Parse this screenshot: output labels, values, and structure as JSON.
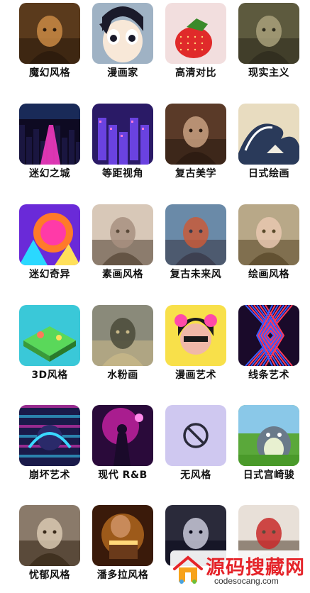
{
  "styles": [
    {
      "label": "魔幻风格",
      "thumb": "magic-portrait",
      "colors": [
        "#5a3a1c",
        "#c98a44",
        "#2b1a0c"
      ]
    },
    {
      "label": "漫画家",
      "thumb": "anime-boy",
      "colors": [
        "#9fb2c4",
        "#ffffff",
        "#1a1a2a"
      ]
    },
    {
      "label": "高清对比",
      "thumb": "strawberry",
      "colors": [
        "#f2dede",
        "#e02a2a",
        "#3a8a2a"
      ]
    },
    {
      "label": "现实主义",
      "thumb": "realism-soldier",
      "colors": [
        "#5d5a3e",
        "#a8a07a",
        "#2e2c1e"
      ]
    },
    {
      "label": "迷幻之城",
      "thumb": "neon-city",
      "colors": [
        "#0e0a22",
        "#ff3cc8",
        "#2a5aaa"
      ]
    },
    {
      "label": "等距视角",
      "thumb": "isometric-city",
      "colors": [
        "#2a1a66",
        "#7a4cff",
        "#ff7ad8"
      ]
    },
    {
      "label": "复古美学",
      "thumb": "vintage-flowers",
      "colors": [
        "#5a3a28",
        "#c8a080",
        "#2a1a10"
      ]
    },
    {
      "label": "日式绘画",
      "thumb": "great-wave",
      "colors": [
        "#e8dcc0",
        "#2a3a5a",
        "#ffffff"
      ]
    },
    {
      "label": "迷幻奇异",
      "thumb": "psychedelic",
      "colors": [
        "#6a2ad8",
        "#ff7a2a",
        "#2ad8ff"
      ]
    },
    {
      "label": "素画风格",
      "thumb": "sketch-portrait",
      "colors": [
        "#d8c8b8",
        "#a89080",
        "#5a4a3a"
      ]
    },
    {
      "label": "复古未来风",
      "thumb": "retro-future",
      "colors": [
        "#6a8aa8",
        "#c85a3a",
        "#3a3a4a"
      ]
    },
    {
      "label": "绘画风格",
      "thumb": "oil-portrait",
      "colors": [
        "#b8a888",
        "#e8c8b0",
        "#5a4a2a"
      ]
    },
    {
      "label": "3D风格",
      "thumb": "3d-island",
      "colors": [
        "#3ac8d8",
        "#5ad85a",
        "#ff7a5a"
      ]
    },
    {
      "label": "水粉画",
      "thumb": "gouache-still",
      "colors": [
        "#8a8a7a",
        "#4a4a3a",
        "#c8b888"
      ]
    },
    {
      "label": "漫画艺术",
      "thumb": "comic-girl",
      "colors": [
        "#f8e04a",
        "#ff4aa8",
        "#1a1a1a"
      ]
    },
    {
      "label": "线条艺术",
      "thumb": "line-art",
      "colors": [
        "#1a0a2a",
        "#ff3a5a",
        "#3a5aff"
      ]
    },
    {
      "label": "崩坏艺术",
      "thumb": "glitch-art",
      "colors": [
        "#1a1a4a",
        "#3ad8ff",
        "#ff3ac8"
      ]
    },
    {
      "label": "现代 R&B",
      "thumb": "rnb-stage",
      "colors": [
        "#2a0a3a",
        "#ff2ac8",
        "#ff8aea"
      ]
    },
    {
      "label": "无风格",
      "thumb": "no-style",
      "colors": [
        "#cfc8f0",
        "#2a2a3a",
        "#cfc8f0"
      ]
    },
    {
      "label": "日式宫崎骏",
      "thumb": "totoro",
      "colors": [
        "#5aa83a",
        "#6a7a8a",
        "#e8f0d0"
      ]
    },
    {
      "label": "忧郁风格",
      "thumb": "melancholy",
      "colors": [
        "#8a7a6a",
        "#d8c8b0",
        "#3a2a1a"
      ]
    },
    {
      "label": "潘多拉风格",
      "thumb": "pandora-box",
      "colors": [
        "#3a1a0a",
        "#ff9a2a",
        "#ffd87a"
      ]
    },
    {
      "label": "",
      "thumb": "dark-portrait",
      "colors": [
        "#2a2a3a",
        "#c8c8d8",
        "#0a0a1a"
      ]
    },
    {
      "label": "",
      "thumb": "masks-crowd",
      "colors": [
        "#e8e0d8",
        "#c82a2a",
        "#5a4a3a"
      ]
    }
  ],
  "watermark": {
    "title": "源码搜藏网",
    "url": "codesocang.com"
  }
}
